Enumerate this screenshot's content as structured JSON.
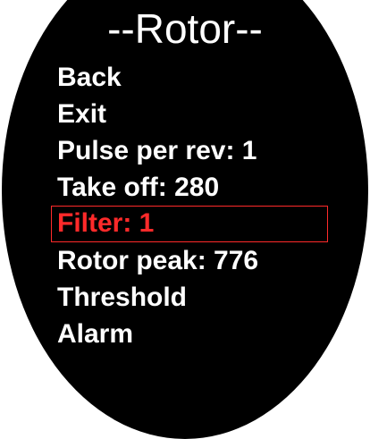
{
  "screen": {
    "title": "--Rotor--",
    "items": [
      {
        "label": "Back"
      },
      {
        "label": "Exit"
      },
      {
        "label": "Pulse per rev: 1"
      },
      {
        "label": "Take off: 280"
      },
      {
        "label": "Filter: 1"
      },
      {
        "label": "Rotor peak: 776"
      },
      {
        "label": "Threshold"
      },
      {
        "label": "Alarm"
      }
    ],
    "selected_label": "Filter: 1",
    "colors": {
      "background": "#000000",
      "text": "#ffffff",
      "selected": "#ff2a2a"
    }
  }
}
